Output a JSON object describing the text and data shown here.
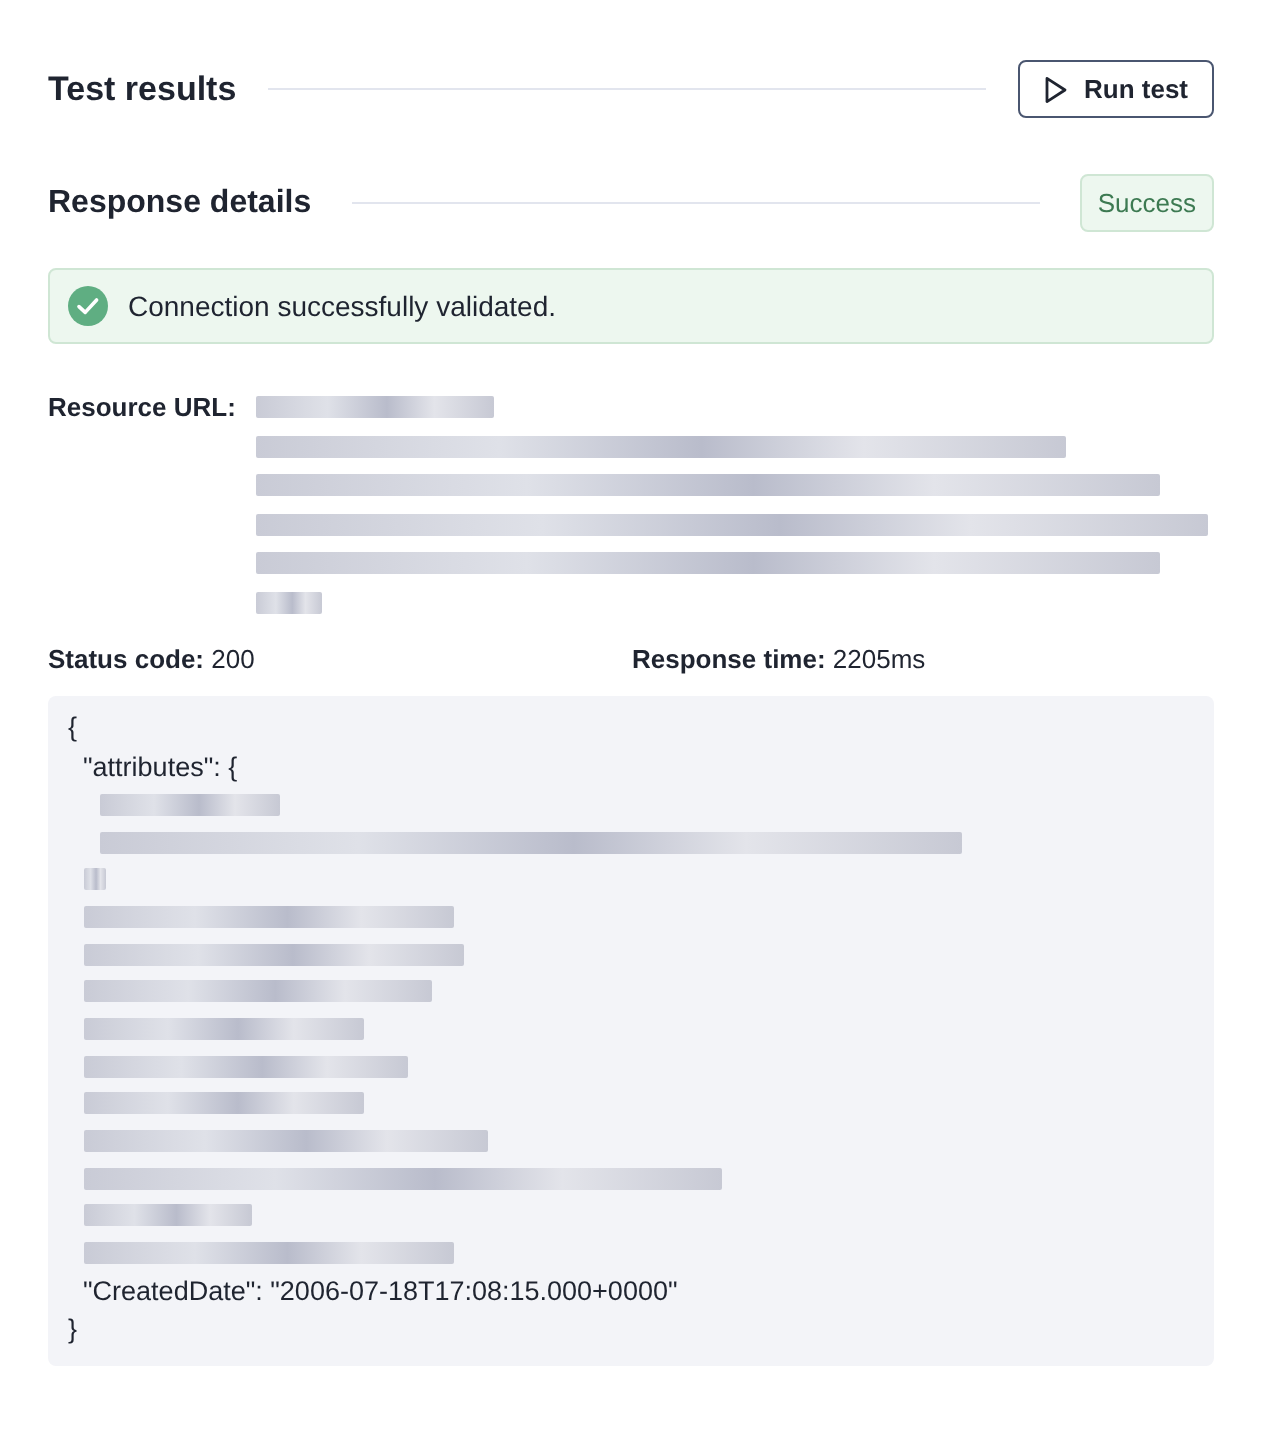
{
  "header": {
    "title": "Test results",
    "run_button": "Run test"
  },
  "response": {
    "title": "Response details",
    "status_badge": "Success",
    "alert": {
      "kind": "success",
      "message": "Connection successfully validated."
    },
    "resource_url": {
      "label": "Resource URL:",
      "lines": [
        {
          "kind": "redacted"
        },
        {
          "kind": "redacted"
        },
        {
          "kind": "redacted"
        },
        {
          "kind": "redacted"
        },
        {
          "kind": "redacted"
        },
        {
          "kind": "redacted"
        }
      ]
    },
    "status_code": {
      "label": "Status code:",
      "value": "200"
    },
    "response_time": {
      "label": "Response time:",
      "value": "2205ms"
    },
    "body_lines": [
      {
        "kind": "text",
        "text": "{"
      },
      {
        "kind": "text",
        "text": "  \"attributes\": {"
      },
      {
        "kind": "redacted_inner"
      },
      {
        "kind": "redacted_inner"
      },
      {
        "kind": "redacted"
      },
      {
        "kind": "redacted"
      },
      {
        "kind": "redacted"
      },
      {
        "kind": "redacted"
      },
      {
        "kind": "redacted"
      },
      {
        "kind": "redacted"
      },
      {
        "kind": "redacted"
      },
      {
        "kind": "redacted"
      },
      {
        "kind": "redacted"
      },
      {
        "kind": "redacted"
      },
      {
        "kind": "redacted"
      },
      {
        "kind": "text",
        "text": "  \"CreatedDate\": \"2006-07-18T17:08:15.000+0000\""
      },
      {
        "kind": "text",
        "text": "}"
      }
    ]
  }
}
